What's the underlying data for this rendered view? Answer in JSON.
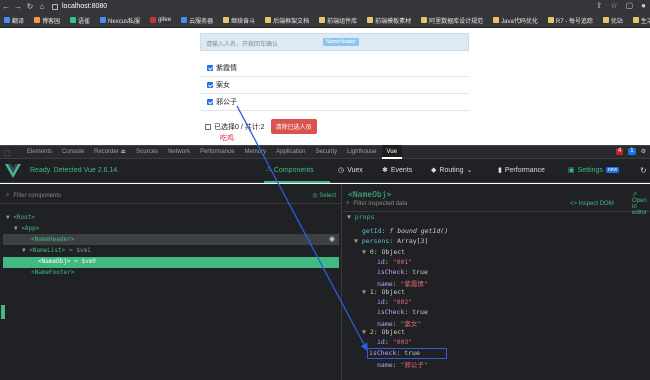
{
  "browser": {
    "url": "localhost:8080",
    "bookmarks": [
      {
        "label": "翻译",
        "color": "#4a8af4"
      },
      {
        "label": "博客园",
        "color": "#f2994a"
      },
      {
        "label": "语雀",
        "color": "#34c38f"
      },
      {
        "label": "Nexcus私服",
        "color": "#4a8af4"
      },
      {
        "label": "gitee",
        "color": "#c0392b"
      },
      {
        "label": "云服务器",
        "color": "#4a8af4"
      },
      {
        "label": "继续奋斗",
        "color": "#e9c46a"
      },
      {
        "label": "后端框架文档",
        "color": "#e9c46a"
      },
      {
        "label": "前端组件库",
        "color": "#e9c46a"
      },
      {
        "label": "前端模板素材",
        "color": "#e9c46a"
      },
      {
        "label": "阿里数据库设计规范",
        "color": "#e9c46a"
      },
      {
        "label": "Java代码优化",
        "color": "#e9c46a"
      },
      {
        "label": "R7 - 每号追踪",
        "color": "#e9c46a"
      },
      {
        "label": "优站",
        "color": "#e9c46a"
      },
      {
        "label": "生活",
        "color": "#e9c46a"
      }
    ]
  },
  "app": {
    "header_placeholder": "请输入人名，开按回车确认",
    "header_tag": "NameHeader",
    "list": [
      {
        "name": "紫霞情",
        "checked": true
      },
      {
        "name": "案女",
        "checked": true
      },
      {
        "name": "邪公子",
        "checked": true
      }
    ],
    "footer": {
      "selected_label": "已选择0 / 共计:2",
      "clear_button": "清除已选人员",
      "red_text": "吃鸡"
    }
  },
  "devtools": {
    "tabs": [
      "Elements",
      "Console",
      "Recorder ⏏",
      "Sources",
      "Network",
      "Performance",
      "Memory",
      "Application",
      "Security",
      "Lighthouse",
      "Vue"
    ],
    "active_tab": "Vue",
    "badge_error": "4",
    "badge_info": "1"
  },
  "vue": {
    "ready_text": "Ready. Detected Vue 2.6.14.",
    "tabs": [
      {
        "label": "Components",
        "active": true
      },
      {
        "label": "Vuex",
        "active": false
      },
      {
        "label": "Events",
        "active": false
      },
      {
        "label": "Routing",
        "active": false
      },
      {
        "label": "Performance",
        "active": false
      },
      {
        "label": "Settings",
        "active": false
      }
    ],
    "settings_badge": "new",
    "filter_components": "Filter components",
    "select_label": "Select",
    "tree": [
      {
        "indent": 0,
        "text": "<Root>",
        "arrow": "▼"
      },
      {
        "indent": 1,
        "text": "<App>",
        "arrow": "▼"
      },
      {
        "indent": 2,
        "text": "<NameHeader>",
        "arrow": ""
      },
      {
        "indent": 2,
        "text": "<NameList>",
        "arrow": "▼",
        "suffix": "= $vm1"
      },
      {
        "indent": 3,
        "text": "<NameObj>",
        "arrow": "",
        "suffix": "= $vm0"
      },
      {
        "indent": 2,
        "text": "<NameFooter>",
        "arrow": ""
      }
    ],
    "selected_component": "<NameObj>",
    "filter_inspected": "Filter inspected data",
    "inspect_dom": "Inspect DOM",
    "open_in_editor": "Open in editor",
    "props_header": "props",
    "props": {
      "getId": "f bound getId()",
      "persons_type": "Array[3]",
      "items": [
        {
          "index": "0: Object",
          "id": "\"001\"",
          "isCheck": "true",
          "name": "\"紫霞情\""
        },
        {
          "index": "1: Object",
          "id": "\"002\"",
          "isCheck": "true",
          "name": "\"案女\""
        },
        {
          "index": "2: Object",
          "id": "\"003\"",
          "isCheck": "true",
          "name": "\"邪公子\""
        }
      ]
    }
  },
  "colors": {
    "vue_green": "#42b983",
    "devtools_bg": "#202124",
    "highlight_blue": "#2f5bdc",
    "clear_red": "#d9534f"
  }
}
